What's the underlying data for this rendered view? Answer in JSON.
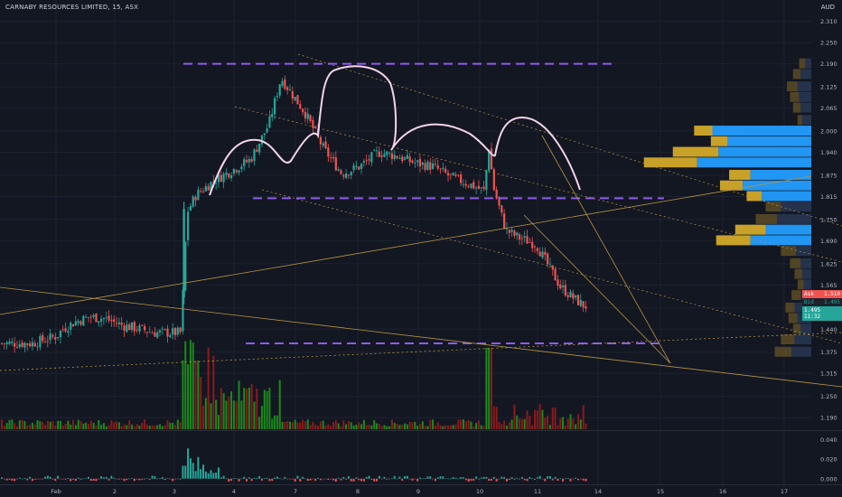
{
  "header": {
    "symbol_name": "CARNABY RESOURCES LIMITED, 15, ASX",
    "currency": "AUD"
  },
  "quote": {
    "ask_label": "Ask",
    "ask_value": "1.510",
    "bid_label": "Bid",
    "bid_value": "1.495",
    "last_value": "1.495",
    "last_sub": "11:32"
  },
  "colors": {
    "background": "#131722",
    "up": "#26a69a",
    "down": "#ef5350",
    "volume_up": "#1b8a1b",
    "volume_down": "#8b1a1a",
    "purple_level": "#8e5cf0",
    "trend_gold": "#b8963e",
    "pattern_outline": "#f3d3e8",
    "vp_blue": "#2196f3",
    "vp_gold": "#c8a128",
    "ask_tag": "#ef5350",
    "bid_tag": "#26a69a"
  },
  "chart_data": {
    "type": "candlestick",
    "symbol": "CARNABY RESOURCES LIMITED, 15, ASX",
    "currency": "AUD",
    "x_axis": {
      "ticks": [
        "Feb",
        "2",
        "3",
        "4",
        "7",
        "8",
        "9",
        "10",
        "11",
        "14",
        "15",
        "16",
        "17"
      ]
    },
    "price_axis": {
      "ticks": [
        "2.310",
        "2.250",
        "2.190",
        "2.125",
        "2.065",
        "2.000",
        "1.940",
        "1.875",
        "1.815",
        "1.750",
        "1.690",
        "1.625",
        "1.565",
        "1.500",
        "1.440",
        "1.375",
        "1.315",
        "1.250",
        "1.190"
      ],
      "range": [
        1.17,
        2.35
      ]
    },
    "oscillator_axis": {
      "ticks": [
        "0.040",
        "0.020",
        "0.000"
      ],
      "range": [
        -0.003,
        0.046
      ]
    },
    "price_path": [
      {
        "x": 0.0,
        "price": 1.4
      },
      {
        "x": 0.5,
        "price": 1.4
      },
      {
        "x": 0.9,
        "price": 1.42
      },
      {
        "x": 1.0,
        "price": 1.44
      },
      {
        "x": 1.2,
        "price": 1.46
      },
      {
        "x": 1.45,
        "price": 1.475
      },
      {
        "x": 1.7,
        "price": 1.47
      },
      {
        "x": 2.0,
        "price": 1.45
      },
      {
        "x": 2.3,
        "price": 1.44
      },
      {
        "x": 2.5,
        "price": 1.43
      },
      {
        "x": 2.8,
        "price": 1.43
      },
      {
        "x": 2.95,
        "price": 1.43
      },
      {
        "x": 3.05,
        "price": 1.77
      },
      {
        "x": 3.2,
        "price": 1.82
      },
      {
        "x": 3.5,
        "price": 1.86
      },
      {
        "x": 3.8,
        "price": 1.89
      },
      {
        "x": 4.1,
        "price": 1.92
      },
      {
        "x": 4.4,
        "price": 2.02
      },
      {
        "x": 4.6,
        "price": 2.15
      },
      {
        "x": 4.8,
        "price": 2.1
      },
      {
        "x": 5.0,
        "price": 2.05
      },
      {
        "x": 5.3,
        "price": 1.95
      },
      {
        "x": 5.6,
        "price": 1.88
      },
      {
        "x": 5.9,
        "price": 1.9
      },
      {
        "x": 6.2,
        "price": 1.94
      },
      {
        "x": 6.5,
        "price": 1.93
      },
      {
        "x": 6.8,
        "price": 1.91
      },
      {
        "x": 7.1,
        "price": 1.9
      },
      {
        "x": 7.4,
        "price": 1.87
      },
      {
        "x": 7.7,
        "price": 1.85
      },
      {
        "x": 7.95,
        "price": 1.83
      },
      {
        "x": 8.02,
        "price": 1.96
      },
      {
        "x": 8.1,
        "price": 1.84
      },
      {
        "x": 8.3,
        "price": 1.72
      },
      {
        "x": 8.5,
        "price": 1.7
      },
      {
        "x": 8.8,
        "price": 1.68
      },
      {
        "x": 9.0,
        "price": 1.62
      },
      {
        "x": 9.2,
        "price": 1.56
      },
      {
        "x": 9.4,
        "price": 1.53
      },
      {
        "x": 9.6,
        "price": 1.505
      }
    ],
    "volume_profile": [
      {
        "price": 2.19,
        "buy": 8,
        "sell": 8
      },
      {
        "price": 2.16,
        "buy": 14,
        "sell": 10
      },
      {
        "price": 2.125,
        "buy": 18,
        "sell": 14
      },
      {
        "price": 2.095,
        "buy": 16,
        "sell": 12
      },
      {
        "price": 2.065,
        "buy": 14,
        "sell": 10
      },
      {
        "price": 2.03,
        "buy": 12,
        "sell": 6
      },
      {
        "price": 2.0,
        "buy": 130,
        "sell": 24
      },
      {
        "price": 1.97,
        "buy": 110,
        "sell": 22
      },
      {
        "price": 1.94,
        "buy": 122,
        "sell": 60
      },
      {
        "price": 1.91,
        "buy": 150,
        "sell": 70
      },
      {
        "price": 1.875,
        "buy": 80,
        "sell": 28
      },
      {
        "price": 1.845,
        "buy": 90,
        "sell": 30
      },
      {
        "price": 1.815,
        "buy": 65,
        "sell": 20
      },
      {
        "price": 1.785,
        "buy": 40,
        "sell": 20
      },
      {
        "price": 1.75,
        "buy": 45,
        "sell": 28
      },
      {
        "price": 1.72,
        "buy": 60,
        "sell": 40
      },
      {
        "price": 1.69,
        "buy": 80,
        "sell": 45
      },
      {
        "price": 1.66,
        "buy": 20,
        "sell": 20
      },
      {
        "price": 1.625,
        "buy": 14,
        "sell": 14
      },
      {
        "price": 1.595,
        "buy": 12,
        "sell": 10
      },
      {
        "price": 1.565,
        "buy": 10,
        "sell": 8
      },
      {
        "price": 1.535,
        "buy": 14,
        "sell": 12
      },
      {
        "price": 1.5,
        "buy": 22,
        "sell": 12
      },
      {
        "price": 1.47,
        "buy": 18,
        "sell": 12
      },
      {
        "price": 1.44,
        "buy": 14,
        "sell": 10
      },
      {
        "price": 1.41,
        "buy": 22,
        "sell": 18
      },
      {
        "price": 1.375,
        "buy": 26,
        "sell": 22
      }
    ],
    "horizontal_levels": [
      2.19,
      1.81,
      1.4
    ],
    "grid": true
  }
}
